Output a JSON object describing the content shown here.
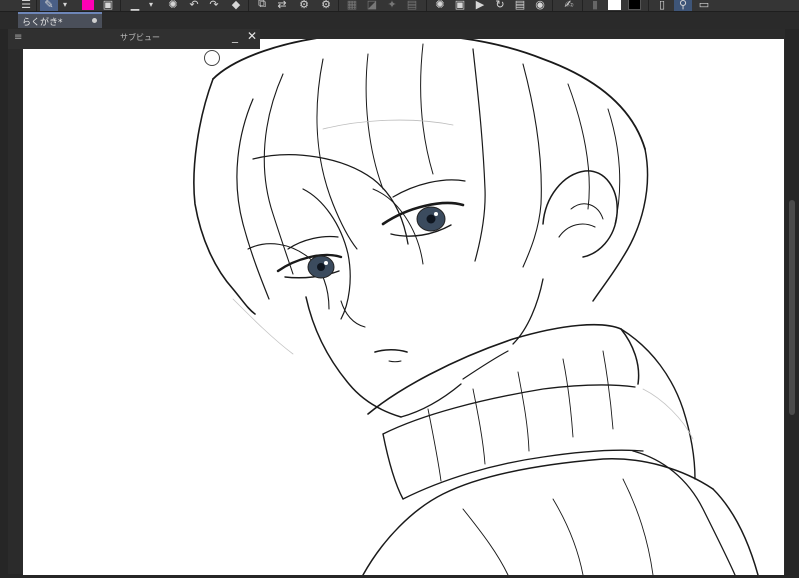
{
  "document_tab": {
    "label": "らくがき*"
  },
  "sub_view": {
    "title": "サブビュー",
    "minimize_label": "_",
    "close_label": "✕"
  },
  "toolbar": {
    "icons": [
      "menu-icon",
      "pen-icon",
      "chevron-down-icon",
      "color-swap-icon",
      "layer-icon",
      "line-icon",
      "loading-icon",
      "undo-icon",
      "fill-icon",
      "transform-icon",
      "flip-icon",
      "settings-icon",
      "grid-icon",
      "ruler-icon",
      "brush-icon",
      "pencil-icon",
      "eraser-icon",
      "copy-icon",
      "play-icon",
      "redo-icon",
      "save-icon",
      "palette-icon",
      "pen-pressure-icon",
      "white-swatch-icon",
      "black-swatch-icon",
      "phone-icon",
      "search-icon",
      "panel-icon"
    ],
    "colors": {
      "magenta": "#ff00b4",
      "white": "#ffffff",
      "black": "#000000",
      "accent": "#6e86b8"
    }
  },
  "canvas": {
    "background": "#ffffff",
    "subject": "line-art-illustration"
  }
}
